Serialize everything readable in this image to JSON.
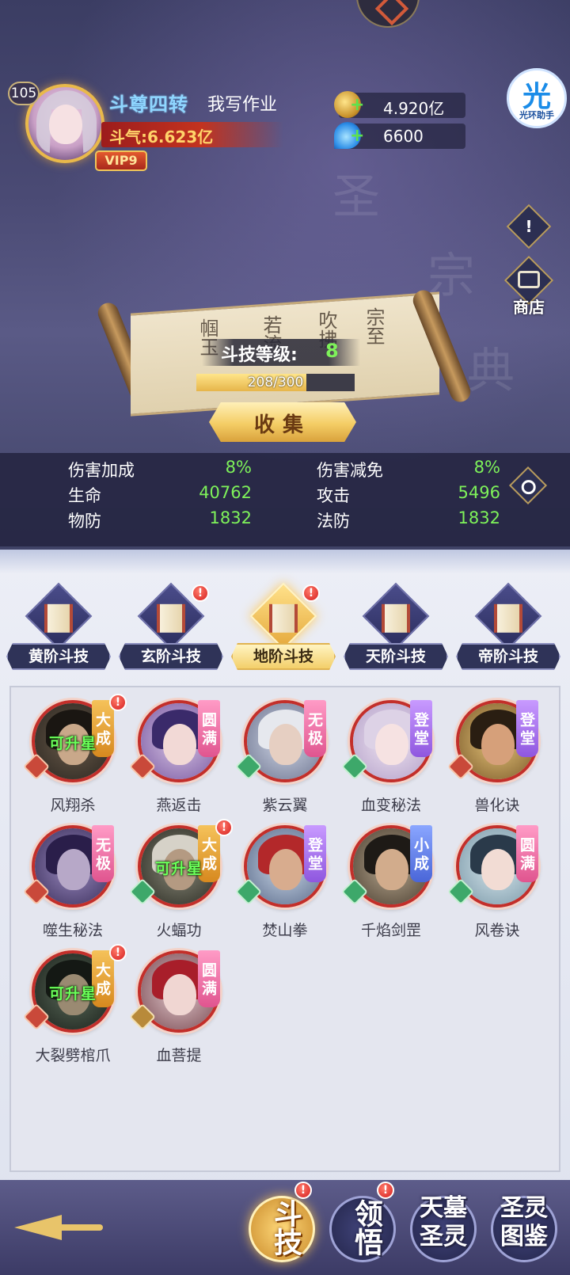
{
  "header": {
    "level": "105",
    "rank_title": "斗尊四转",
    "player_name": "我写作业",
    "power": "斗气:6.623亿",
    "vip": "VIP9"
  },
  "resources": [
    {
      "icon": "gold-coin-icon",
      "value": "4.920亿"
    },
    {
      "icon": "spirit-flame-icon",
      "value": "6600"
    }
  ],
  "side_buttons": {
    "helper_glyph": "光",
    "helper_caption": "光环助手",
    "info_glyph": "!",
    "shop_label": "商店"
  },
  "scroll": {
    "level_label": "斗技等级:",
    "level_value": "8",
    "progress_text": "208/300",
    "progress_current": 208,
    "progress_max": 300,
    "collect_label": "收集"
  },
  "stats": [
    {
      "label": "伤害加成",
      "value": "8%"
    },
    {
      "label": "伤害减免",
      "value": "8%"
    },
    {
      "label": "生命",
      "value": "40762"
    },
    {
      "label": "攻击",
      "value": "5496"
    },
    {
      "label": "物防",
      "value": "1832"
    },
    {
      "label": "法防",
      "value": "1832"
    }
  ],
  "tabs": [
    {
      "label": "黄阶斗技",
      "active": false,
      "alert": false
    },
    {
      "label": "玄阶斗技",
      "active": false,
      "alert": true
    },
    {
      "label": "地阶斗技",
      "active": true,
      "alert": true
    },
    {
      "label": "天阶斗技",
      "active": false,
      "alert": false
    },
    {
      "label": "帝阶斗技",
      "active": false,
      "alert": false
    }
  ],
  "skills": [
    {
      "name": "风翔杀",
      "grade": "大成",
      "grade_color": "gold",
      "element": "fire",
      "star_up": "可升星",
      "alert": true
    },
    {
      "name": "燕返击",
      "grade": "圆满",
      "grade_color": "pink",
      "element": "fire",
      "star_up": "",
      "alert": false
    },
    {
      "name": "紫云翼",
      "grade": "无极",
      "grade_color": "pink",
      "element": "wood",
      "star_up": "",
      "alert": false
    },
    {
      "name": "血变秘法",
      "grade": "登堂",
      "grade_color": "purple",
      "element": "wood",
      "star_up": "",
      "alert": false
    },
    {
      "name": "兽化诀",
      "grade": "登堂",
      "grade_color": "purple",
      "element": "fire",
      "star_up": "",
      "alert": false
    },
    {
      "name": "噬生秘法",
      "grade": "无极",
      "grade_color": "pink",
      "element": "fire",
      "star_up": "",
      "alert": false
    },
    {
      "name": "火蝠功",
      "grade": "大成",
      "grade_color": "gold",
      "element": "wood",
      "star_up": "可升星",
      "alert": true
    },
    {
      "name": "焚山拳",
      "grade": "登堂",
      "grade_color": "purple",
      "element": "wood",
      "star_up": "",
      "alert": false
    },
    {
      "name": "千焰剑罡",
      "grade": "小成",
      "grade_color": "blue",
      "element": "wood",
      "star_up": "",
      "alert": false
    },
    {
      "name": "风卷诀",
      "grade": "圆满",
      "grade_color": "pink",
      "element": "wood",
      "star_up": "",
      "alert": false
    },
    {
      "name": "大裂劈棺爪",
      "grade": "大成",
      "grade_color": "gold",
      "element": "fire",
      "star_up": "可升星",
      "alert": true
    },
    {
      "name": "血菩提",
      "grade": "圆满",
      "grade_color": "pink",
      "element": "earth",
      "star_up": "",
      "alert": false
    }
  ],
  "bottom_nav": [
    {
      "label": "斗技",
      "active": true,
      "alert": true
    },
    {
      "label": "领悟",
      "active": false,
      "alert": true
    },
    {
      "label": "天墓圣灵",
      "active": false,
      "alert": false
    },
    {
      "label": "圣灵图鉴",
      "active": false,
      "alert": false
    }
  ],
  "alert_glyph": "!",
  "colors": {
    "accent_gold": "#f4cd65",
    "stat_green": "#7ef25a",
    "grade_gold": "#d7891f",
    "grade_purple": "#8f57df",
    "grade_blue": "#4a66d8",
    "grade_pink": "#e0558f"
  }
}
